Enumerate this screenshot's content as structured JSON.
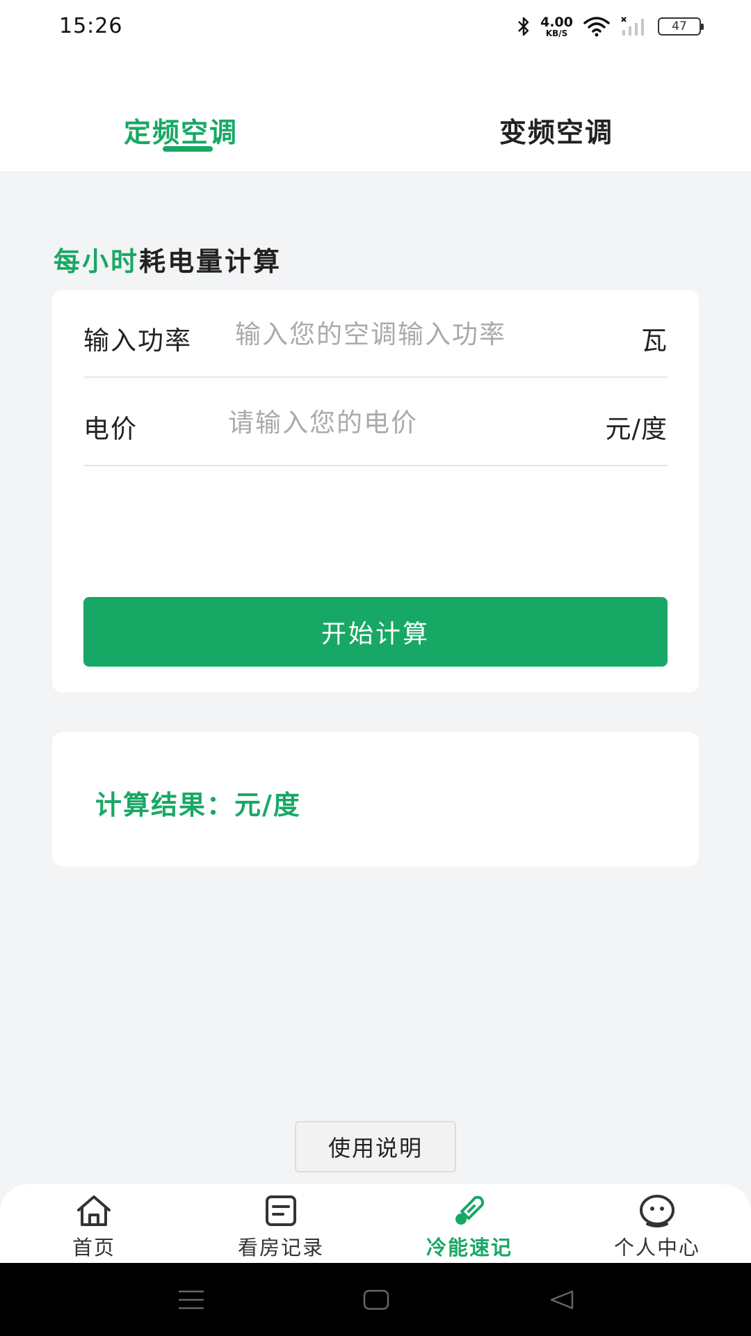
{
  "status_bar": {
    "time": "15:26",
    "net_speed_value": "4.00",
    "net_speed_unit": "KB/S",
    "battery": "47",
    "icons": [
      "bluetooth-icon",
      "wifi-icon",
      "signal-icon",
      "battery-icon"
    ]
  },
  "tabs": [
    {
      "label": "定频空调",
      "active": true
    },
    {
      "label": "变频空调",
      "active": false
    }
  ],
  "section_title": {
    "highlight": "每小时",
    "rest": "耗电量计算"
  },
  "form": {
    "power": {
      "label": "输入功率",
      "value": "",
      "placeholder": "输入您的空调输入功率",
      "unit": "瓦"
    },
    "price": {
      "label": "电价",
      "value": "",
      "placeholder": "请输入您的电价",
      "unit": "元/度"
    },
    "submit_label": "开始计算"
  },
  "result": {
    "text": "计算结果：元/度"
  },
  "usage_button_label": "使用说明",
  "bottom_nav": [
    {
      "label": "首页",
      "icon": "home-icon",
      "active": false
    },
    {
      "label": "看房记录",
      "icon": "document-icon",
      "active": false
    },
    {
      "label": "冷能速记",
      "icon": "thermometer-icon",
      "active": true
    },
    {
      "label": "个人中心",
      "icon": "smiley-icon",
      "active": false
    }
  ],
  "colors": {
    "accent": "#18a865",
    "background": "#f3f4f6",
    "card": "#ffffff"
  }
}
